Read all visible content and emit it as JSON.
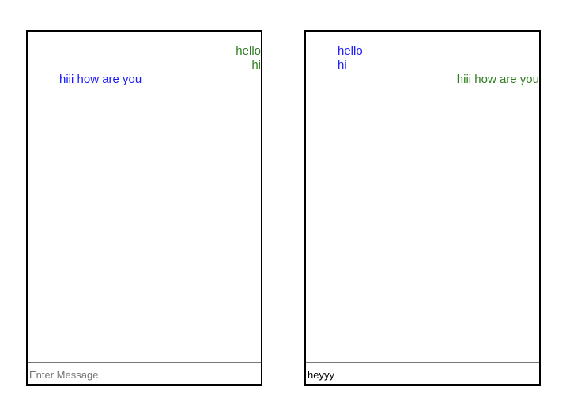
{
  "colors": {
    "sent": "#2e7d1f",
    "received": "#1a1aff",
    "border": "#000000"
  },
  "left_panel": {
    "messages": [
      {
        "text": "hello",
        "kind": "sent"
      },
      {
        "text": "hi",
        "kind": "sent"
      },
      {
        "text": "hiii how are you",
        "kind": "received"
      }
    ],
    "input": {
      "value": "",
      "placeholder": "Enter Message"
    }
  },
  "right_panel": {
    "messages": [
      {
        "text": "hello",
        "kind": "received"
      },
      {
        "text": "hi",
        "kind": "received"
      },
      {
        "text": "hiii how are you",
        "kind": "sent"
      }
    ],
    "input": {
      "value": "heyyy",
      "placeholder": "Enter Message"
    }
  }
}
